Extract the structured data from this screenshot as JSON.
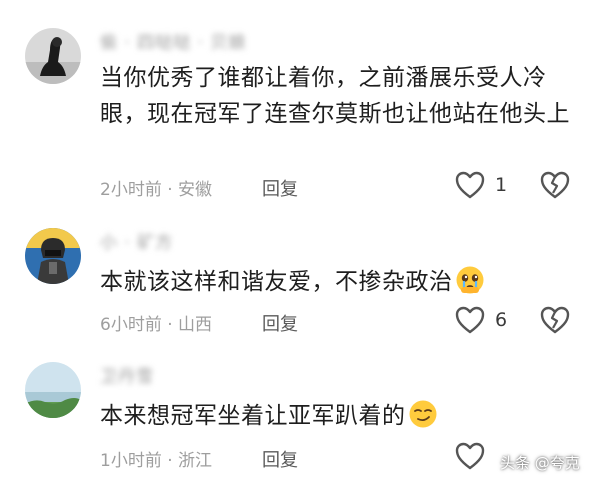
{
  "comments": [
    {
      "author": "偷 · 四哒哒 · 贝娘",
      "text": "当你优秀了谁都让着你，之前潘展乐受人冷眼，现在冠军了连查尔莫斯也让他站在他头上",
      "time": "2小时前",
      "location": "安徽",
      "reply_label": "回复",
      "likes": "1",
      "emoji": null
    },
    {
      "author": "小 · 矿方",
      "text": "本就该这样和谐友爱，不掺杂政治",
      "time": "6小时前",
      "location": "山西",
      "reply_label": "回复",
      "likes": "6",
      "emoji": "crying-face-emoji"
    },
    {
      "author": "卫丹雪",
      "text": "本来想冠军坐着让亚军趴着的",
      "time": "1小时前",
      "location": "浙江",
      "reply_label": "回复",
      "likes": "",
      "emoji": "smirk-face-emoji"
    }
  ],
  "separator": "·",
  "watermark": "头条 @夸克",
  "icons": {
    "like": "heart-outline-icon",
    "dislike": "broken-heart-icon"
  },
  "colors": {
    "text": "#1e1e1e",
    "meta": "#9e9e9e",
    "reply": "#5a5a5a",
    "icon": "#555555"
  }
}
